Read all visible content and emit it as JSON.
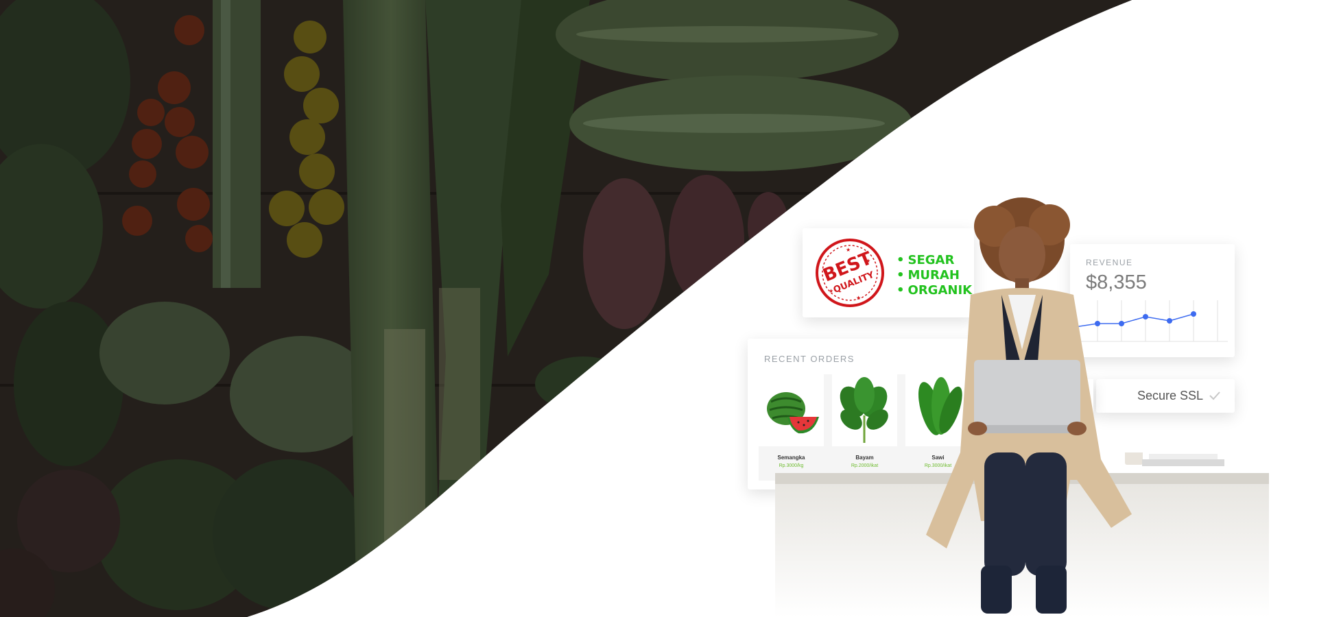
{
  "quality_card": {
    "seal_text_top": "BEST",
    "seal_text_bottom": "QUALITY",
    "bullets": [
      "SEGAR",
      "MURAH",
      "ORGANIK"
    ]
  },
  "revenue_card": {
    "label": "REVENUE",
    "value": "$8,355"
  },
  "ssl_card": {
    "label": "Secure SSL"
  },
  "orders_card": {
    "title": "RECENT ORDERS",
    "products": [
      {
        "name": "Semangka",
        "price": "Rp.3000/kg"
      },
      {
        "name": "Bayam",
        "price": "Rp.2000/ikat"
      },
      {
        "name": "Sawi",
        "price": "Rp.3000/ikat"
      }
    ]
  },
  "colors": {
    "accent_green": "#22c21e",
    "seal_red": "#d0161b",
    "chart_blue": "#3d6bf0"
  }
}
